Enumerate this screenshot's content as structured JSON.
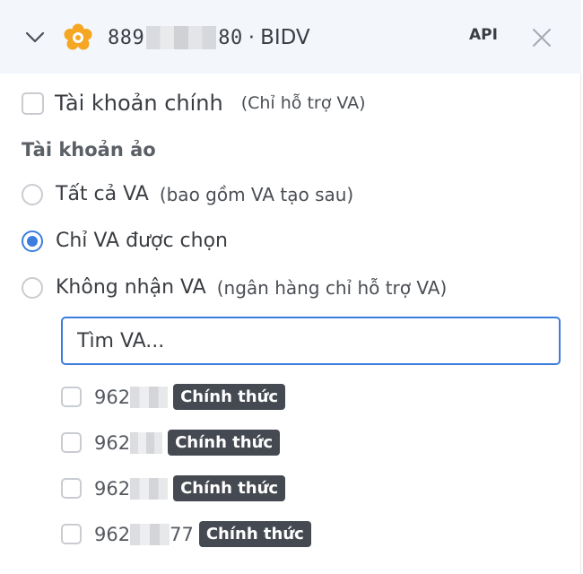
{
  "header": {
    "account_prefix": "889",
    "account_suffix": "80",
    "separator": "·",
    "bank": "BIDV",
    "api_label": "API"
  },
  "main_account": {
    "label": "Tài khoản chính",
    "hint": "(Chỉ hỗ trợ VA)",
    "checked": false
  },
  "virtual_accounts": {
    "section_title": "Tài khoản ảo",
    "options": [
      {
        "label": "Tất cả VA",
        "hint": "(bao gồm VA tạo sau)",
        "selected": false
      },
      {
        "label": "Chỉ VA được chọn",
        "hint": "",
        "selected": true
      },
      {
        "label": "Không nhận VA",
        "hint": "(ngân hàng chỉ hỗ trợ VA)",
        "selected": false
      }
    ],
    "search_placeholder": "Tìm VA...",
    "items": [
      {
        "prefix": "962",
        "suffix": "",
        "badge": "Chính thức",
        "checked": false
      },
      {
        "prefix": "962",
        "suffix": "",
        "badge": "Chính thức",
        "checked": false
      },
      {
        "prefix": "962",
        "suffix": "",
        "badge": "Chính thức",
        "checked": false
      },
      {
        "prefix": "962",
        "suffix": "77",
        "badge": "Chính thức",
        "checked": false
      }
    ]
  },
  "colors": {
    "accent": "#3b7ddd",
    "header_bg": "#f3f7fc",
    "badge_bg": "#454a52",
    "logo": "#f5a623"
  },
  "icons": [
    "chevron-down-icon",
    "bank-logo-icon",
    "close-icon"
  ]
}
